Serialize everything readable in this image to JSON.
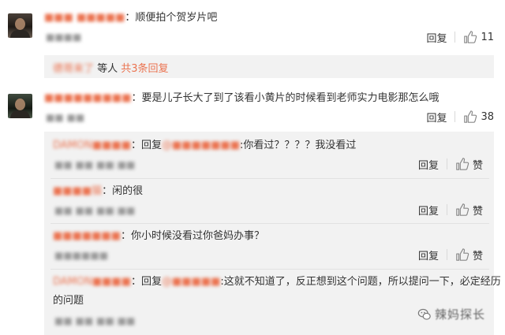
{
  "comments": [
    {
      "username": "■■■ ■■■■■",
      "text": "：顺便拍个贺岁片吧",
      "meta": "■■■■",
      "reply_label": "回复",
      "like_count": "11",
      "summary": {
        "names": "德哥来了",
        "and_others": " 等人 ",
        "more": "共3条回复"
      }
    },
    {
      "username": "■■■■■■■■■",
      "text": "：要是儿子长大了到了该看小黄片的时候看到老师实力电影那怎么哦",
      "meta": "■■ ■■",
      "reply_label": "回复",
      "like_count": "38"
    }
  ],
  "replies": [
    {
      "username": "DAMON■■■■",
      "text_pre": "：回复",
      "mention": "@■■■■■■■",
      "text": ":你看过？？？？我没看过",
      "meta": "■■ ■■ ■■:■■",
      "reply_label": "回复",
      "like_label": "赞"
    },
    {
      "username": "■■■■猫",
      "text": "：闲的很",
      "meta": "■■ ■■ ■■:■■",
      "reply_label": "回复",
      "like_label": "赞"
    },
    {
      "username": "■■■■■■■",
      "text": "：你小时候没看过你爸妈办事？",
      "meta": "■■■■■■",
      "reply_label": "回复",
      "like_label": "赞"
    },
    {
      "username": "DAMON■■■■",
      "text_pre": "：回复",
      "mention": "@■■■■■",
      "text": ":这就不知道了，反正想到这个问题，所以提问一下，必定经历",
      "text_line2": "的问题",
      "meta": "■■ ■■ ■■:■■",
      "reply_label": "回复",
      "like_label": "赞"
    }
  ],
  "watermark": {
    "text": "辣妈探长",
    "icon": "wechat-icon"
  },
  "colors": {
    "accent": "#eb7350",
    "sub_bg": "#f2f2f2",
    "text": "#333333",
    "meta": "#999999"
  }
}
